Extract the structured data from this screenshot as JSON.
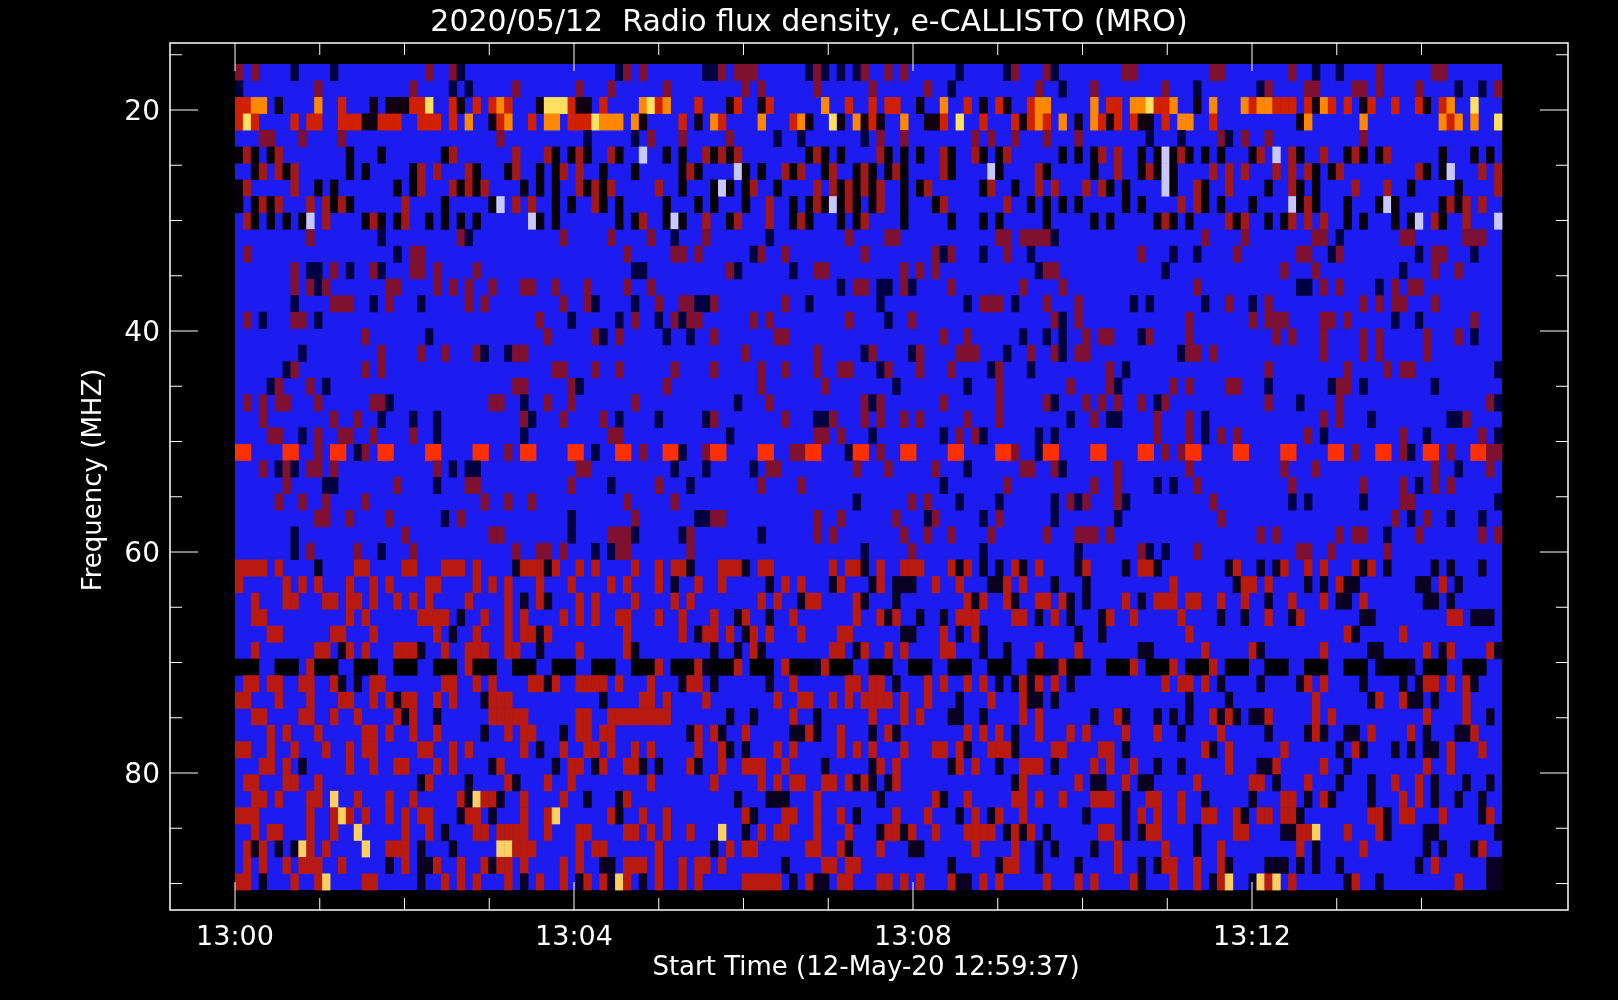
{
  "plot": {
    "title": "2020/05/12  Radio flux density, e-CALLISTO (MRO)",
    "y_axis": {
      "label": "Frequency (MHZ)",
      "ticks": [
        "20",
        "40",
        "60",
        "80"
      ]
    },
    "x_axis": {
      "label": "Start Time (12-May-20 12:59:37)",
      "ticks": [
        "13:00",
        "13:04",
        "13:08",
        "13:12"
      ]
    }
  }
}
